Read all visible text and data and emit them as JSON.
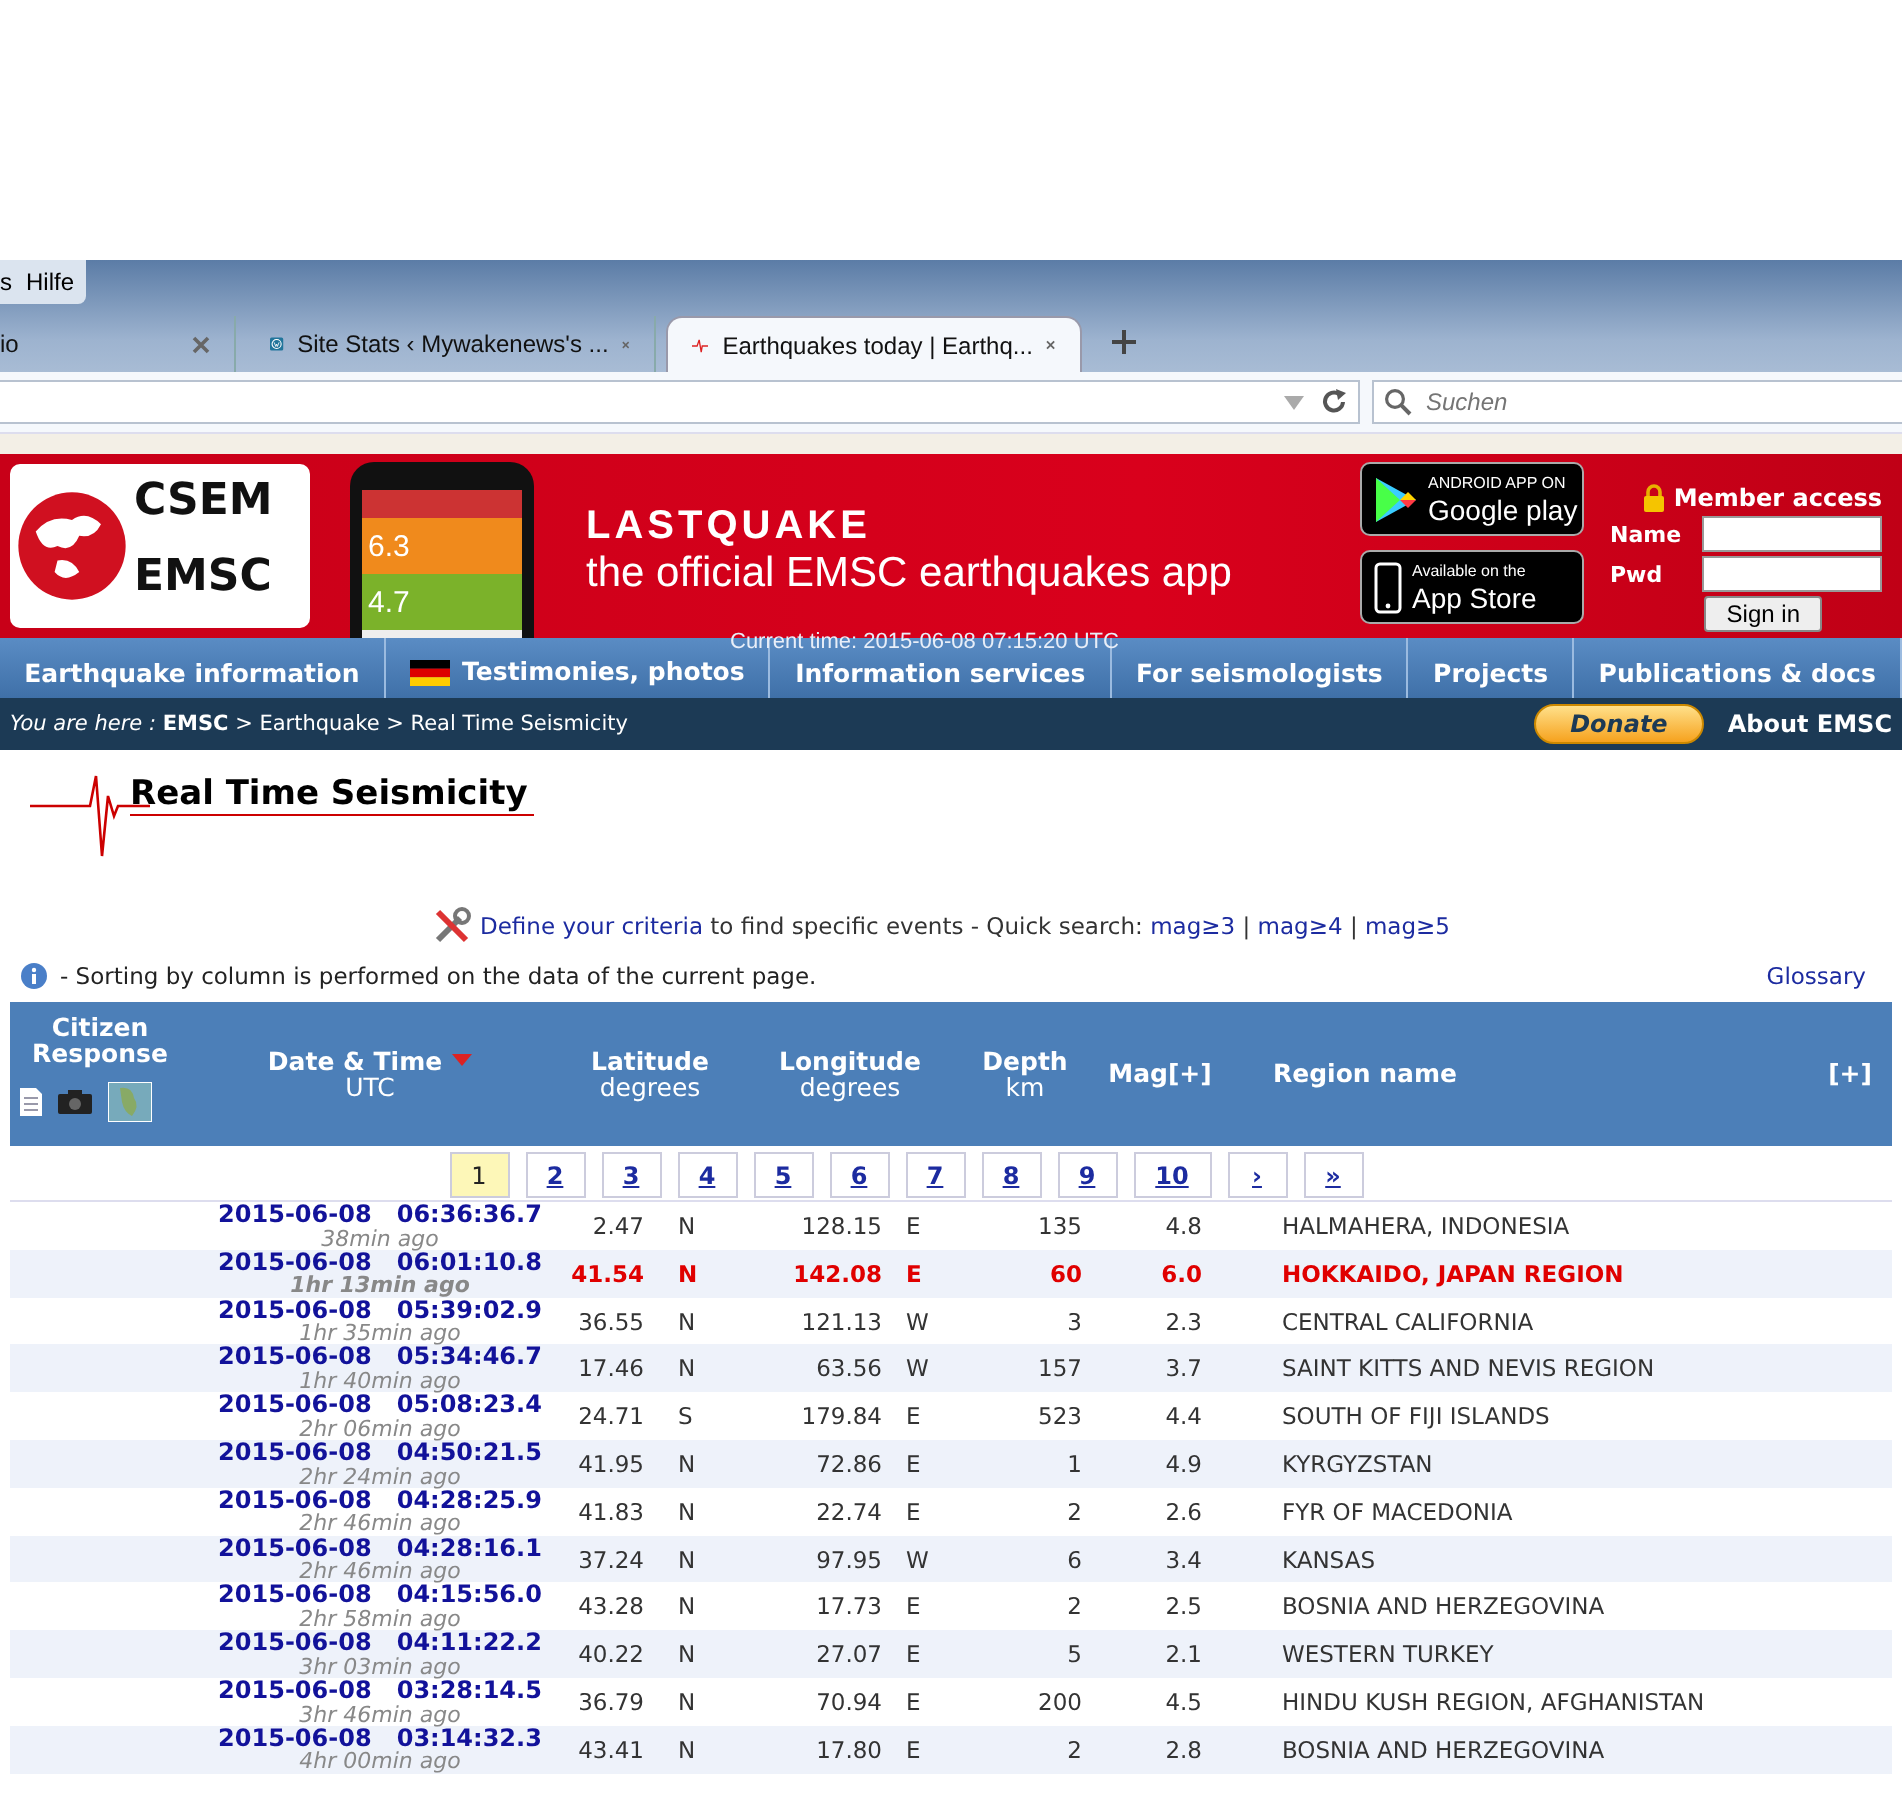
{
  "menu_bar": {
    "items": [
      {
        "label": "s"
      },
      {
        "label": "Hilfe"
      }
    ]
  },
  "tabs": [
    {
      "label": "io",
      "selected": false
    },
    {
      "label": "Site Stats ‹ Mywakenews's ...",
      "selected": false
    },
    {
      "label": "Earthquakes today | Earthq...",
      "selected": true
    }
  ],
  "search": {
    "placeholder": "Suchen"
  },
  "banner": {
    "logo_top": "CSEM",
    "logo_bottom": "EMSC",
    "phone_values": [
      "6.3",
      "4.7"
    ],
    "app_title": "LASTQUAKE",
    "app_subtitle": "the official EMSC earthquakes app",
    "stores": [
      {
        "kind": "google",
        "small": "ANDROID APP ON",
        "big": "Google play"
      },
      {
        "kind": "apple",
        "small": "Available on the",
        "big": "App Store"
      }
    ],
    "member": {
      "title": "Member access",
      "name_label": "Name",
      "pwd_label": "Pwd",
      "button": "Sign in"
    }
  },
  "current_time": "Current time: 2015-06-08 07:15:20 UTC",
  "nav": [
    {
      "label": "Earthquake information",
      "flag": false
    },
    {
      "label": "Testimonies, photos",
      "flag": true
    },
    {
      "label": "Information services",
      "flag": false
    },
    {
      "label": "For seismologists",
      "flag": false
    },
    {
      "label": "Projects",
      "flag": false
    },
    {
      "label": "Publications & docs",
      "flag": false
    }
  ],
  "breadcrumb": "*You are here :* **EMSC** > Earthquake > Real Time Seismicity",
  "donate": "Donate",
  "about": "About EMSC",
  "page_title": "Real Time Seismicity",
  "criteria": {
    "link": "Define your criteria",
    "text": " to find specific events - Quick search: ",
    "mags": [
      "mag≥3",
      "mag≥4",
      "mag≥5"
    ],
    "separator": "|"
  },
  "info": "- Sorting by column is performed on the data of the current page.",
  "glossary": "Glossary",
  "table": {
    "columns": [
      {
        "title": "Citizen Response"
      },
      {
        "title": "Date & Time",
        "sub": "UTC"
      },
      {
        "title": "Latitude",
        "sub": "degrees"
      },
      {
        "title": "Longitude",
        "sub": "degrees"
      },
      {
        "title": "Depth",
        "sub": "km"
      },
      {
        "title": "Mag[+]"
      },
      {
        "title": "Region name"
      },
      {
        "title": "[+]"
      }
    ],
    "pages": [
      {
        "label": "1",
        "selected": true
      },
      {
        "label": "2",
        "selected": false
      },
      {
        "label": "3",
        "selected": false
      },
      {
        "label": "4",
        "selected": false
      },
      {
        "label": "5",
        "selected": false
      },
      {
        "label": "6",
        "selected": false
      },
      {
        "label": "7",
        "selected": false
      },
      {
        "label": "8",
        "selected": false
      },
      {
        "label": "9",
        "selected": false
      },
      {
        "label": "10",
        "selected": false
      },
      {
        "label": "›",
        "selected": false
      },
      {
        "label": "»",
        "selected": false
      }
    ],
    "rows": [
      {
        "date": "2015-06-08",
        "time": "06:36:36.7",
        "ago": "38min ago",
        "lat": "2.47",
        "ns": "N",
        "lon": "128.15",
        "ew": "E",
        "depth": "135",
        "mag": "4.8",
        "region": "HALMAHERA, INDONESIA",
        "highlighted": false
      },
      {
        "date": "2015-06-08",
        "time": "06:01:10.8",
        "ago": "1hr 13min ago",
        "lat": "41.54",
        "ns": "N",
        "lon": "142.08",
        "ew": "E",
        "depth": "60",
        "mag": "6.0",
        "region": "HOKKAIDO, JAPAN REGION",
        "highlighted": true
      },
      {
        "date": "2015-06-08",
        "time": "05:39:02.9",
        "ago": "1hr 35min ago",
        "lat": "36.55",
        "ns": "N",
        "lon": "121.13",
        "ew": "W",
        "depth": "3",
        "mag": "2.3",
        "region": "CENTRAL CALIFORNIA",
        "highlighted": false
      },
      {
        "date": "2015-06-08",
        "time": "05:34:46.7",
        "ago": "1hr 40min ago",
        "lat": "17.46",
        "ns": "N",
        "lon": "63.56",
        "ew": "W",
        "depth": "157",
        "mag": "3.7",
        "region": "SAINT KITTS AND NEVIS REGION",
        "highlighted": false
      },
      {
        "date": "2015-06-08",
        "time": "05:08:23.4",
        "ago": "2hr 06min ago",
        "lat": "24.71",
        "ns": "S",
        "lon": "179.84",
        "ew": "E",
        "depth": "523",
        "mag": "4.4",
        "region": "SOUTH OF FIJI ISLANDS",
        "highlighted": false
      },
      {
        "date": "2015-06-08",
        "time": "04:50:21.5",
        "ago": "2hr 24min ago",
        "lat": "41.95",
        "ns": "N",
        "lon": "72.86",
        "ew": "E",
        "depth": "1",
        "mag": "4.9",
        "region": "KYRGYZSTAN",
        "highlighted": false
      },
      {
        "date": "2015-06-08",
        "time": "04:28:25.9",
        "ago": "2hr 46min ago",
        "lat": "41.83",
        "ns": "N",
        "lon": "22.74",
        "ew": "E",
        "depth": "2",
        "mag": "2.6",
        "region": "FYR OF MACEDONIA",
        "highlighted": false
      },
      {
        "date": "2015-06-08",
        "time": "04:28:16.1",
        "ago": "2hr 46min ago",
        "lat": "37.24",
        "ns": "N",
        "lon": "97.95",
        "ew": "W",
        "depth": "6",
        "mag": "3.4",
        "region": "KANSAS",
        "highlighted": false
      },
      {
        "date": "2015-06-08",
        "time": "04:15:56.0",
        "ago": "2hr 58min ago",
        "lat": "43.28",
        "ns": "N",
        "lon": "17.73",
        "ew": "E",
        "depth": "2",
        "mag": "2.5",
        "region": "BOSNIA AND HERZEGOVINA",
        "highlighted": false
      },
      {
        "date": "2015-06-08",
        "time": "04:11:22.2",
        "ago": "3hr 03min ago",
        "lat": "40.22",
        "ns": "N",
        "lon": "27.07",
        "ew": "E",
        "depth": "5",
        "mag": "2.1",
        "region": "WESTERN TURKEY",
        "highlighted": false
      },
      {
        "date": "2015-06-08",
        "time": "03:28:14.5",
        "ago": "3hr 46min ago",
        "lat": "36.79",
        "ns": "N",
        "lon": "70.94",
        "ew": "E",
        "depth": "200",
        "mag": "4.5",
        "region": "HINDU KUSH REGION, AFGHANISTAN",
        "highlighted": false
      },
      {
        "date": "2015-06-08",
        "time": "03:14:32.3",
        "ago": "4hr 00min ago",
        "lat": "43.41",
        "ns": "N",
        "lon": "17.80",
        "ew": "E",
        "depth": "2",
        "mag": "2.8",
        "region": "BOSNIA AND HERZEGOVINA",
        "highlighted": false
      }
    ]
  }
}
